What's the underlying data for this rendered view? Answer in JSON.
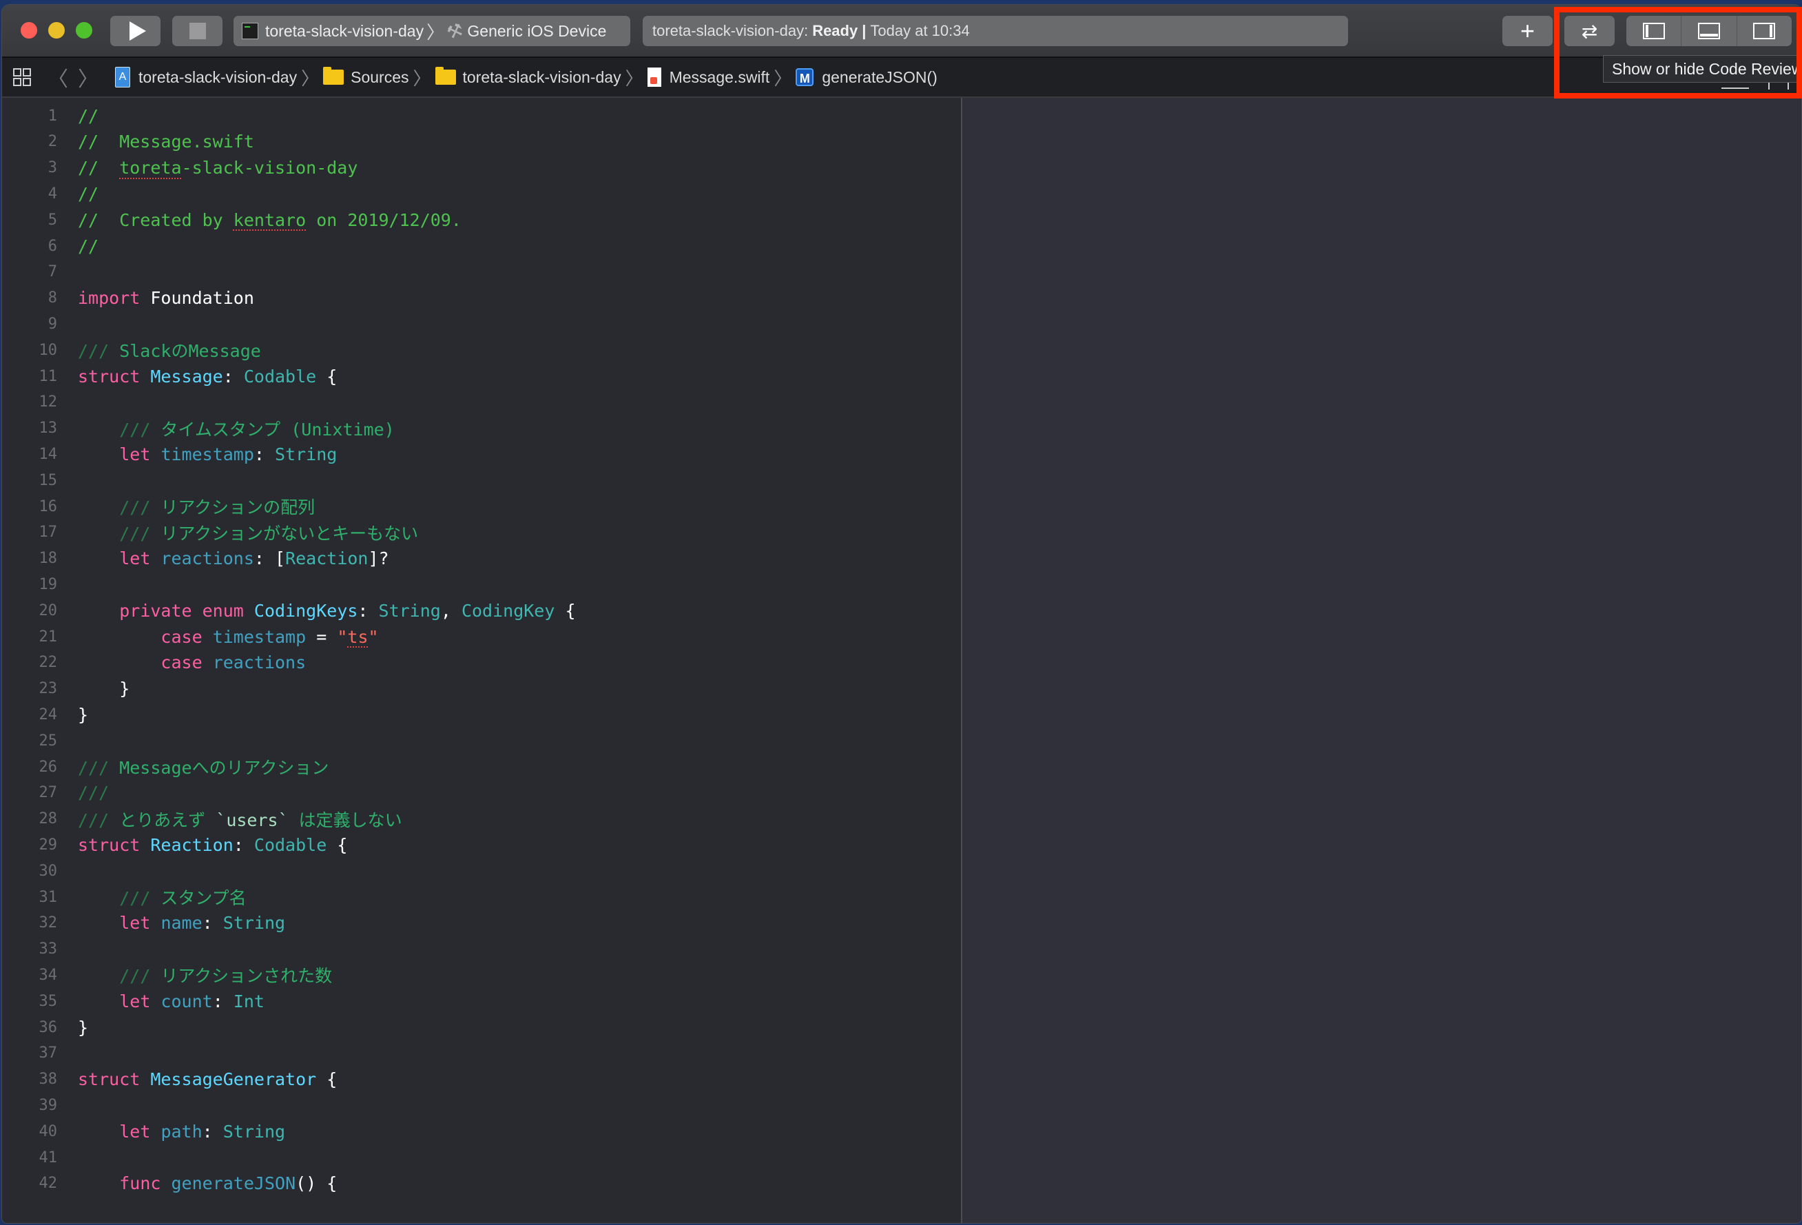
{
  "toolbar": {
    "scheme": {
      "project": "toreta-slack-vision-day",
      "device": "Generic iOS Device"
    },
    "activity": {
      "project": "toreta-slack-vision-day:",
      "status": "Ready",
      "separator": "|",
      "time": "Today at 10:34"
    },
    "buttons": {
      "run": "play-icon",
      "stop": "stop-icon",
      "add": "+",
      "code_review": "⇄",
      "navigator": "left-pane-icon",
      "debug_area": "bottom-pane-icon",
      "inspector": "right-pane-icon"
    }
  },
  "jumpbar": {
    "crumbs": [
      {
        "label": "toreta-slack-vision-day",
        "icon": "project-icon"
      },
      {
        "label": "Sources",
        "icon": "folder-icon"
      },
      {
        "label": "toreta-slack-vision-day",
        "icon": "folder-icon"
      },
      {
        "label": "Message.swift",
        "icon": "swift-file-icon"
      },
      {
        "label": "generateJSON()",
        "icon": "method-icon",
        "badge": "M"
      }
    ]
  },
  "tooltip": {
    "text": "Show or hide Code Review"
  },
  "editor": {
    "lines": [
      {
        "n": "1",
        "segs": [
          [
            "c-comment",
            "//"
          ]
        ]
      },
      {
        "n": "2",
        "segs": [
          [
            "c-comment",
            "//  Message.swift"
          ]
        ]
      },
      {
        "n": "3",
        "segs": [
          [
            "c-comment",
            "//  "
          ],
          [
            "c-comment squiggle",
            "toreta"
          ],
          [
            "c-comment",
            "-slack-vision-day"
          ]
        ]
      },
      {
        "n": "4",
        "segs": [
          [
            "c-comment",
            "//"
          ]
        ]
      },
      {
        "n": "5",
        "segs": [
          [
            "c-comment",
            "//  Created by "
          ],
          [
            "c-comment squiggle",
            "kentaro"
          ],
          [
            "c-comment",
            " on 2019/12/09."
          ]
        ]
      },
      {
        "n": "6",
        "segs": [
          [
            "c-comment",
            "//"
          ]
        ]
      },
      {
        "n": "7",
        "segs": []
      },
      {
        "n": "8",
        "segs": [
          [
            "c-kw",
            "import"
          ],
          [
            "c-plain",
            " Foundation"
          ]
        ]
      },
      {
        "n": "9",
        "segs": []
      },
      {
        "n": "10",
        "segs": [
          [
            "c-docslash",
            "///"
          ],
          [
            "c-doc",
            " SlackのMessage"
          ]
        ]
      },
      {
        "n": "11",
        "segs": [
          [
            "c-kw",
            "struct"
          ],
          [
            "c-plain",
            " "
          ],
          [
            "c-type-decl",
            "Message"
          ],
          [
            "c-plain",
            ": "
          ],
          [
            "c-type",
            "Codable"
          ],
          [
            "c-plain",
            " {"
          ]
        ]
      },
      {
        "n": "12",
        "segs": []
      },
      {
        "n": "13",
        "segs": [
          [
            "c-plain",
            "    "
          ],
          [
            "c-docslash",
            "///"
          ],
          [
            "c-doc",
            " タイムスタンプ (Unixtime)"
          ]
        ]
      },
      {
        "n": "14",
        "segs": [
          [
            "c-plain",
            "    "
          ],
          [
            "c-kw",
            "let"
          ],
          [
            "c-plain",
            " "
          ],
          [
            "c-prop",
            "timestamp"
          ],
          [
            "c-plain",
            ": "
          ],
          [
            "c-type",
            "String"
          ]
        ]
      },
      {
        "n": "15",
        "segs": []
      },
      {
        "n": "16",
        "segs": [
          [
            "c-plain",
            "    "
          ],
          [
            "c-docslash",
            "///"
          ],
          [
            "c-doc",
            " リアクションの配列"
          ]
        ]
      },
      {
        "n": "17",
        "segs": [
          [
            "c-plain",
            "    "
          ],
          [
            "c-docslash",
            "///"
          ],
          [
            "c-doc",
            " リアクションがないとキーもない"
          ]
        ]
      },
      {
        "n": "18",
        "segs": [
          [
            "c-plain",
            "    "
          ],
          [
            "c-kw",
            "let"
          ],
          [
            "c-plain",
            " "
          ],
          [
            "c-prop",
            "reactions"
          ],
          [
            "c-plain",
            ": ["
          ],
          [
            "c-type",
            "Reaction"
          ],
          [
            "c-plain",
            "]?"
          ]
        ]
      },
      {
        "n": "19",
        "segs": []
      },
      {
        "n": "20",
        "segs": [
          [
            "c-plain",
            "    "
          ],
          [
            "c-kw",
            "private enum"
          ],
          [
            "c-plain",
            " "
          ],
          [
            "c-type-decl",
            "CodingKeys"
          ],
          [
            "c-plain",
            ": "
          ],
          [
            "c-type",
            "String"
          ],
          [
            "c-plain",
            ", "
          ],
          [
            "c-type",
            "CodingKey"
          ],
          [
            "c-plain",
            " {"
          ]
        ]
      },
      {
        "n": "21",
        "segs": [
          [
            "c-plain",
            "        "
          ],
          [
            "c-kw",
            "case"
          ],
          [
            "c-plain",
            " "
          ],
          [
            "c-prop",
            "timestamp"
          ],
          [
            "c-plain",
            " = "
          ],
          [
            "c-str",
            "\""
          ],
          [
            "c-str squiggle",
            "ts"
          ],
          [
            "c-str",
            "\""
          ]
        ]
      },
      {
        "n": "22",
        "segs": [
          [
            "c-plain",
            "        "
          ],
          [
            "c-kw",
            "case"
          ],
          [
            "c-plain",
            " "
          ],
          [
            "c-prop",
            "reactions"
          ]
        ]
      },
      {
        "n": "23",
        "segs": [
          [
            "c-plain",
            "    }"
          ]
        ]
      },
      {
        "n": "24",
        "segs": [
          [
            "c-plain",
            "}"
          ]
        ]
      },
      {
        "n": "25",
        "segs": []
      },
      {
        "n": "26",
        "segs": [
          [
            "c-docslash",
            "///"
          ],
          [
            "c-doc",
            " Messageへのリアクション"
          ]
        ]
      },
      {
        "n": "27",
        "segs": [
          [
            "c-docslash",
            "///"
          ]
        ]
      },
      {
        "n": "28",
        "segs": [
          [
            "c-docslash",
            "///"
          ],
          [
            "c-doc",
            " とりあえず "
          ],
          [
            "c-codeinline",
            "`users`"
          ],
          [
            "c-doc",
            " は定義しない"
          ]
        ]
      },
      {
        "n": "29",
        "segs": [
          [
            "c-kw",
            "struct"
          ],
          [
            "c-plain",
            " "
          ],
          [
            "c-type-decl",
            "Reaction"
          ],
          [
            "c-plain",
            ": "
          ],
          [
            "c-type",
            "Codable"
          ],
          [
            "c-plain",
            " {"
          ]
        ]
      },
      {
        "n": "30",
        "segs": []
      },
      {
        "n": "31",
        "segs": [
          [
            "c-plain",
            "    "
          ],
          [
            "c-docslash",
            "///"
          ],
          [
            "c-doc",
            " スタンプ名"
          ]
        ]
      },
      {
        "n": "32",
        "segs": [
          [
            "c-plain",
            "    "
          ],
          [
            "c-kw",
            "let"
          ],
          [
            "c-plain",
            " "
          ],
          [
            "c-prop",
            "name"
          ],
          [
            "c-plain",
            ": "
          ],
          [
            "c-type",
            "String"
          ]
        ]
      },
      {
        "n": "33",
        "segs": []
      },
      {
        "n": "34",
        "segs": [
          [
            "c-plain",
            "    "
          ],
          [
            "c-docslash",
            "///"
          ],
          [
            "c-doc",
            " リアクションされた数"
          ]
        ]
      },
      {
        "n": "35",
        "segs": [
          [
            "c-plain",
            "    "
          ],
          [
            "c-kw",
            "let"
          ],
          [
            "c-plain",
            " "
          ],
          [
            "c-prop",
            "count"
          ],
          [
            "c-plain",
            ": "
          ],
          [
            "c-type",
            "Int"
          ]
        ]
      },
      {
        "n": "36",
        "segs": [
          [
            "c-plain",
            "}"
          ]
        ]
      },
      {
        "n": "37",
        "segs": []
      },
      {
        "n": "38",
        "segs": [
          [
            "c-kw",
            "struct"
          ],
          [
            "c-plain",
            " "
          ],
          [
            "c-type-decl",
            "MessageGenerator"
          ],
          [
            "c-plain",
            " {"
          ]
        ]
      },
      {
        "n": "39",
        "segs": []
      },
      {
        "n": "40",
        "segs": [
          [
            "c-plain",
            "    "
          ],
          [
            "c-kw",
            "let"
          ],
          [
            "c-plain",
            " "
          ],
          [
            "c-prop",
            "path"
          ],
          [
            "c-plain",
            ": "
          ],
          [
            "c-type",
            "String"
          ]
        ]
      },
      {
        "n": "41",
        "segs": []
      },
      {
        "n": "42",
        "segs": [
          [
            "c-plain",
            "    "
          ],
          [
            "c-kw",
            "func"
          ],
          [
            "c-plain",
            " "
          ],
          [
            "c-prop",
            "generateJSON"
          ],
          [
            "c-plain",
            "() {"
          ]
        ]
      }
    ]
  },
  "colors": {
    "highlight": "#ff2a00",
    "editor_bg": "#292a30",
    "keyword": "#fc5fa3",
    "type_decl": "#5dd8ff",
    "type": "#3fb6b0",
    "comment": "#4ec24e",
    "string": "#fc6a5d"
  }
}
